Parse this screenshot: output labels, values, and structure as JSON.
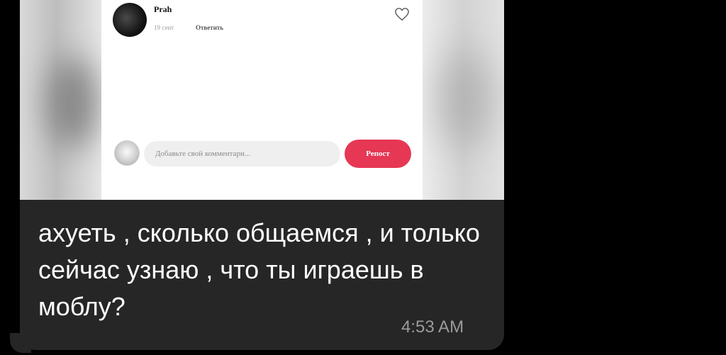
{
  "comment": {
    "username": "Prah",
    "date": "19 сент",
    "reply_label": "Ответить",
    "input_placeholder": "Добавьте свой комментари...",
    "repost_label": "Репост",
    "accent_color": "#e63755"
  },
  "message": {
    "text": "ахуеть , сколько общаемся , и только сейчас узнаю , что ты играешь в моблу?",
    "time": "4:53 AM",
    "bubble_color": "#262626"
  }
}
